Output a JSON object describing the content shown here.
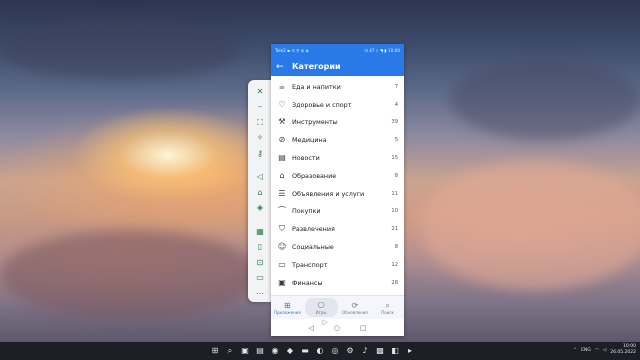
{
  "phone": {
    "statusbar": {
      "left": "Tele2 ▪ ⊙ ⚲ ◎ ◈",
      "right": "⊡ 47 ᛒ ◥ ▮ 10:00"
    },
    "appbar": {
      "title": "Категории",
      "back_icon": "arrow-left-icon"
    },
    "categories": [
      {
        "label": "Еда и напитки",
        "count": "7",
        "icon": "cup-icon",
        "glyph": "☕"
      },
      {
        "label": "Здоровье и спорт",
        "count": "4",
        "icon": "heart-icon",
        "glyph": "♡"
      },
      {
        "label": "Инструменты",
        "count": "39",
        "icon": "wrench-icon",
        "glyph": "⚒"
      },
      {
        "label": "Медицина",
        "count": "5",
        "icon": "pill-icon",
        "glyph": "⊘"
      },
      {
        "label": "Новости",
        "count": "15",
        "icon": "newspaper-icon",
        "glyph": "▤"
      },
      {
        "label": "Образование",
        "count": "8",
        "icon": "graduation-cap-icon",
        "glyph": "⌂"
      },
      {
        "label": "Объявления и услуги",
        "count": "11",
        "icon": "list-icon",
        "glyph": "☰"
      },
      {
        "label": "Покупки",
        "count": "10",
        "icon": "hanger-icon",
        "glyph": "⌒"
      },
      {
        "label": "Развлечения",
        "count": "21",
        "icon": "shield-icon",
        "glyph": "⛉"
      },
      {
        "label": "Социальные",
        "count": "8",
        "icon": "smile-icon",
        "glyph": "☺"
      },
      {
        "label": "Транспорт",
        "count": "12",
        "icon": "car-icon",
        "glyph": "▭"
      },
      {
        "label": "Финансы",
        "count": "28",
        "icon": "wallet-icon",
        "glyph": "▣"
      }
    ],
    "bottom_nav": [
      {
        "label": "Приложения",
        "icon": "apps-grid-icon",
        "glyph": "⊞",
        "state": "active"
      },
      {
        "label": "Игры",
        "icon": "gamepad-icon",
        "glyph": "⎔",
        "state": "hover"
      },
      {
        "label": "Обновления",
        "icon": "update-icon",
        "glyph": "⟳",
        "state": ""
      },
      {
        "label": "Поиск",
        "icon": "search-icon",
        "glyph": "⌕",
        "state": ""
      }
    ],
    "system_nav": {
      "back": "◁",
      "home": "○",
      "recents": "□"
    }
  },
  "sidebar": {
    "top_icons": [
      "close-icon",
      "minimize-icon",
      "fullscreen-icon",
      "pin-icon",
      "keyboard-icon"
    ],
    "top_glyphs": [
      "✕",
      "–",
      "⛶",
      "✧",
      "⚷"
    ],
    "mid_icons": [
      "volume-icon",
      "shake-icon",
      "rotate-icon"
    ],
    "mid_glyphs": [
      "◁",
      "⌂",
      "◈"
    ],
    "bottom_icons": [
      "screenshot-icon",
      "phone-icon",
      "record-icon",
      "folder-icon",
      "more-icon"
    ],
    "bottom_glyphs": [
      "▦",
      "▯",
      "⊡",
      "▭",
      "⋯"
    ]
  },
  "taskbar": {
    "apps": [
      "windows-logo-icon",
      "search-icon",
      "task-view-icon",
      "widgets-icon",
      "chrome-icon",
      "brave-icon",
      "explorer-icon",
      "edge-icon",
      "viber-icon",
      "settings-icon",
      "music-icon",
      "photos-icon",
      "store-icon",
      "terminal-icon"
    ],
    "app_glyphs": [
      "⊞",
      "⌕",
      "▣",
      "▤",
      "◉",
      "◆",
      "▬",
      "◐",
      "◎",
      "⚙",
      "♪",
      "▩",
      "◧",
      "▸"
    ],
    "tray": {
      "lang": "ENG",
      "time": "10:00",
      "date": "26.05.2022"
    }
  }
}
